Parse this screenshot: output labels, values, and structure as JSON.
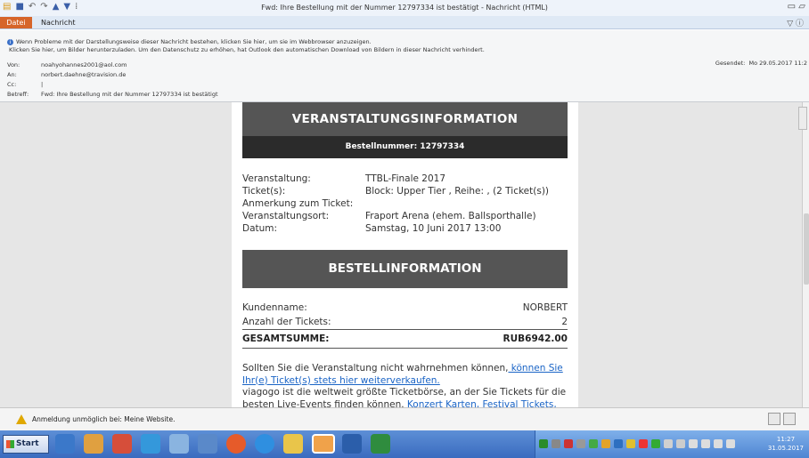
{
  "window": {
    "title": "Fwd: Ihre Bestellung mit der Nummer 12797334 ist bestätigt - Nachricht (HTML)"
  },
  "ribbon": {
    "file_tab": "Datei",
    "message_tab": "Nachricht"
  },
  "header": {
    "info_line1": "Wenn Probleme mit der Darstellungsweise dieser Nachricht bestehen, klicken Sie hier, um sie im Webbrowser anzuzeigen.",
    "info_line2": "Klicken Sie hier, um Bilder herunterzuladen. Um den Datenschutz zu erhöhen, hat Outlook den automatischen Download von Bildern in dieser Nachricht verhindert.",
    "from_label": "Von:",
    "from_value": "noahyohannes2001@aol.com",
    "to_label": "An:",
    "to_value": "norbert.daehne@travision.de",
    "cc_label": "Cc:",
    "cc_value": "|",
    "subject_label": "Betreff:",
    "subject_value": "Fwd: Ihre Bestellung mit der Nummer 12797334 ist bestätigt",
    "sent_label": "Gesendet:",
    "sent_value": "Mo 29.05.2017 11:2"
  },
  "email": {
    "event_header": "VERANSTALTUNGSINFORMATION",
    "order_number": "Bestellnummer: 12797334",
    "event_rows": [
      {
        "key": "Veranstaltung:",
        "value": "TTBL-Finale 2017"
      },
      {
        "key": "Ticket(s):",
        "value": "Block: Upper Tier , Reihe: , (2 Ticket(s))"
      },
      {
        "key": "Anmerkung zum Ticket:",
        "value": ""
      },
      {
        "key": "Veranstaltungsort:",
        "value": "Fraport Arena (ehem. Ballsporthalle)"
      },
      {
        "key": "Datum:",
        "value": "Samstag, 10 Juni 2017 13:00"
      }
    ],
    "order_header": "BESTELLINFORMATION",
    "customer_label": "Kundenname:",
    "customer_value": "NORBERT",
    "tickets_label": "Anzahl der Tickets:",
    "tickets_value": "2",
    "total_label": "GESAMTSUMME:",
    "total_value": "RUB6942.00",
    "para1_a": "Sollten Sie die Veranstaltung nicht wahrnehmen können,",
    "para1_link": " können Sie Ihr(e) Ticket(s) stets hier weiterverkaufen.",
    "para2_a": "viagogo ist die weltweit größte Ticketbörse, an der Sie Tickets für die besten Live-Events finden können. ",
    "para2_link": "Konzert Karten, Festival Tickets, Sports Tickets"
  },
  "notification": {
    "text": "Anmeldung unmöglich bei: Meine Website."
  },
  "taskbar": {
    "start_label": "Start",
    "time": "11:27",
    "date": "31.05.2017"
  }
}
